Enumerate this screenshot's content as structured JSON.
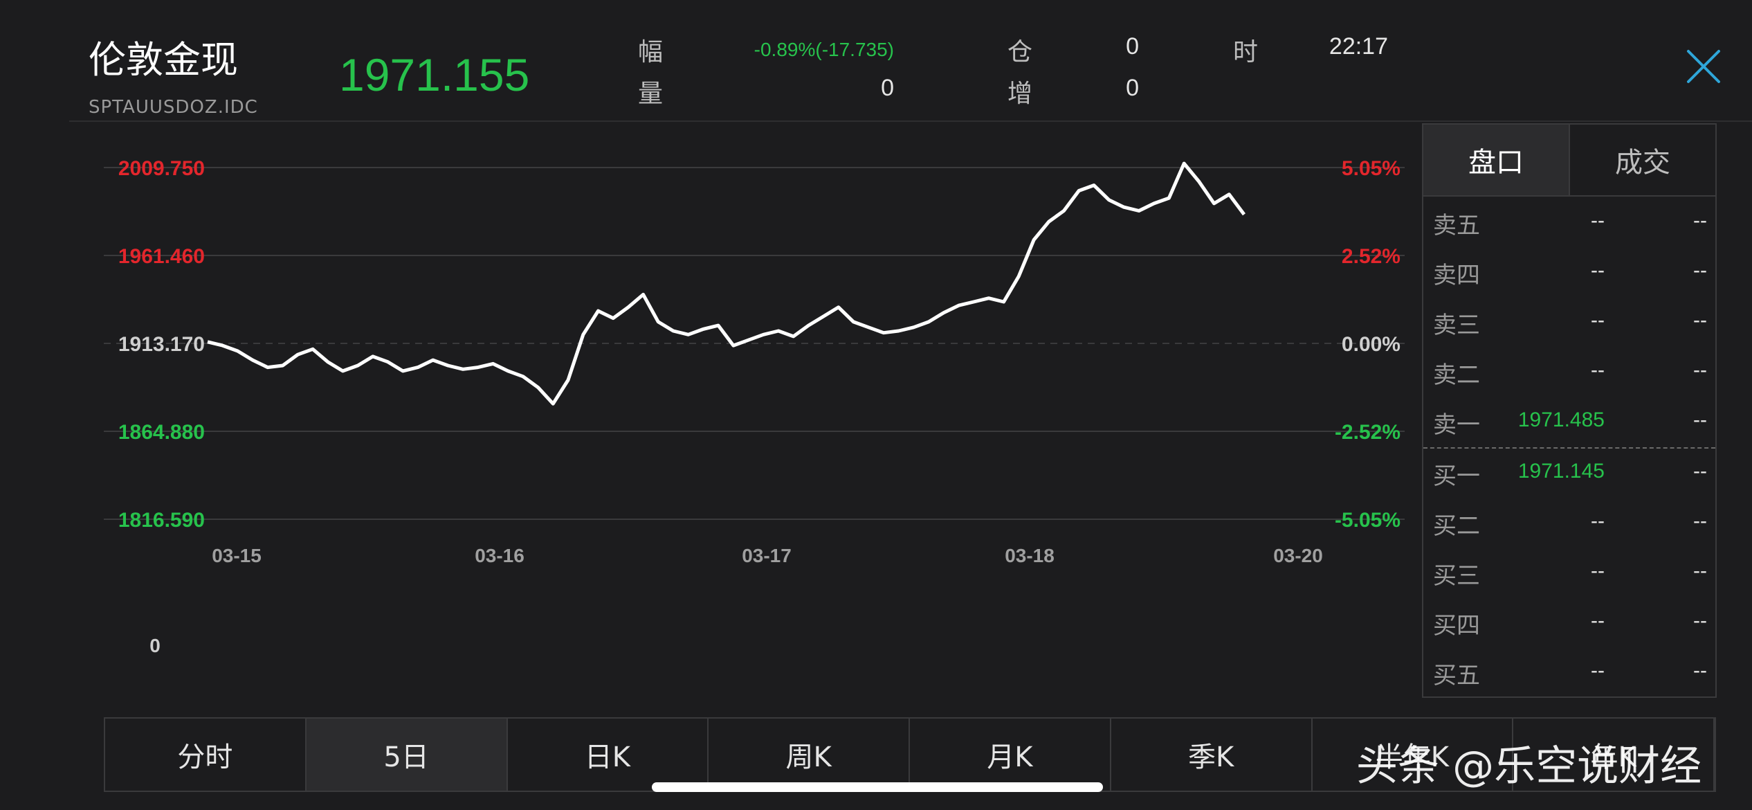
{
  "header": {
    "title": "伦敦金现",
    "code": "SPTAUUSDOZ.IDC",
    "price": "1971.155",
    "amplitude_label": "幅",
    "amplitude_value": "-0.89%(-17.735)",
    "volume_label": "量",
    "volume_value": "0",
    "position_label": "仓",
    "position_value": "0",
    "increase_label": "增",
    "increase_value": "0",
    "time_label": "时",
    "time_value": "22:17",
    "close_icon": "close-icon"
  },
  "chart_data": {
    "type": "line",
    "y_left_ticks": [
      "2009.750",
      "1961.460",
      "1913.170",
      "1864.880",
      "1816.590"
    ],
    "y_right_ticks": [
      "5.05%",
      "2.52%",
      "0.00%",
      "-2.52%",
      "-5.05%"
    ],
    "x_ticks": [
      "03-15",
      "03-16",
      "03-17",
      "03-18",
      "03-20"
    ],
    "volume_label": "0",
    "base_price": 1913.17,
    "ylim": [
      1816.59,
      2009.75
    ],
    "colors": {
      "up": "#e3262c",
      "down": "#27c24c",
      "flat": "#cfcfcf",
      "line": "#ffffff"
    },
    "series": [
      {
        "values": [
          1914,
          1912,
          1909,
          1904,
          1900,
          1901,
          1907,
          1910,
          1903,
          1898,
          1901,
          1906,
          1903,
          1898,
          1900,
          1904,
          1901,
          1899,
          1900,
          1902,
          1898,
          1895,
          1889,
          1880,
          1893,
          1918,
          1931,
          1927,
          1933,
          1940,
          1925,
          1920,
          1918,
          1921,
          1923,
          1912,
          1915,
          1918,
          1920,
          1917,
          1923,
          1928,
          1933,
          1925,
          1922,
          1919,
          1920,
          1922,
          1925,
          1930,
          1934,
          1936,
          1938,
          1936,
          1950,
          1970,
          1980,
          1986,
          1997,
          2000,
          1992,
          1988,
          1986,
          1990,
          1993,
          2012,
          2002,
          1990,
          1995,
          1984
        ]
      }
    ]
  },
  "order_book": {
    "tabs": [
      "盘口",
      "成交"
    ],
    "rows": [
      {
        "label": "卖五",
        "price": "--",
        "volume": "--"
      },
      {
        "label": "卖四",
        "price": "--",
        "volume": "--"
      },
      {
        "label": "卖三",
        "price": "--",
        "volume": "--"
      },
      {
        "label": "卖二",
        "price": "--",
        "volume": "--"
      },
      {
        "label": "卖一",
        "price": "1971.485",
        "volume": "--"
      },
      {
        "label": "买一",
        "price": "1971.145",
        "volume": "--"
      },
      {
        "label": "买二",
        "price": "--",
        "volume": "--"
      },
      {
        "label": "买三",
        "price": "--",
        "volume": "--"
      },
      {
        "label": "买四",
        "price": "--",
        "volume": "--"
      },
      {
        "label": "买五",
        "price": "--",
        "volume": "--"
      }
    ]
  },
  "period_tabs": [
    "分时",
    "5日",
    "日K",
    "周K",
    "月K",
    "季K",
    "半年K",
    "年K"
  ],
  "active_period": "5日",
  "watermark": "头条 @乐空说财经"
}
